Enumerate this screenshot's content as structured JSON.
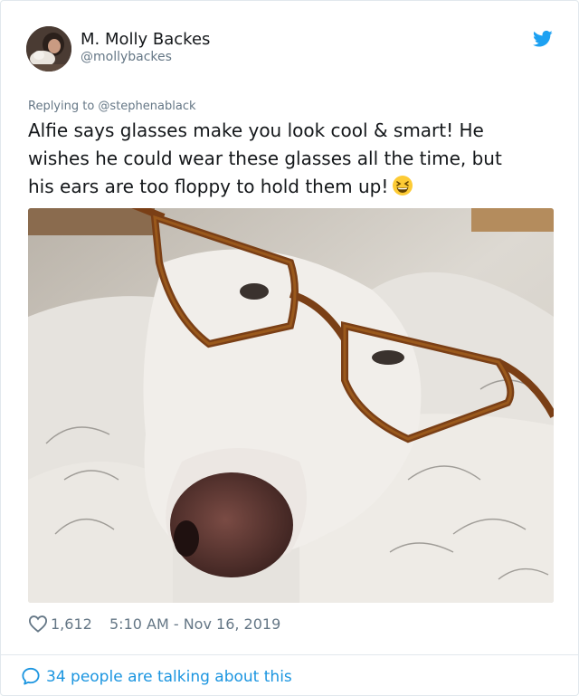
{
  "tweet": {
    "author": {
      "name": "M. Molly Backes",
      "handle": "@mollybackes"
    },
    "replying_to": "Replying to @stephenablack",
    "text_lines": [
      "Alfie says glasses make you look cool & smart! He",
      "wishes he could wear these glasses all the time, but",
      "his ears are too floppy to hold them up!"
    ],
    "emoji": "grinning-squinting-face",
    "photo": {
      "description_icon": "dog-with-glasses-photo"
    },
    "likes": "1,612",
    "timestamp": "5:10 AM - Nov 16, 2019",
    "talking": "34 people are talking about this"
  },
  "colors": {
    "twitter_blue": "#1da1f2",
    "link_blue": "#1b95e0",
    "secondary_text": "#657786",
    "border": "#e1e8ed"
  }
}
